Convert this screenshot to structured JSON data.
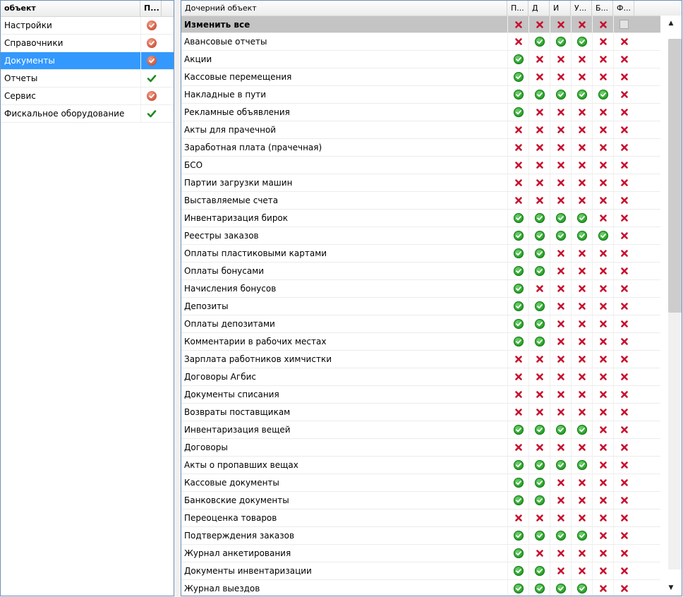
{
  "left": {
    "headers": [
      "объект",
      "П..."
    ],
    "rows": [
      {
        "name": "Настройки",
        "icon": "partial"
      },
      {
        "name": "Справочники",
        "icon": "partial"
      },
      {
        "name": "Документы",
        "icon": "partial",
        "selected": true
      },
      {
        "name": "Отчеты",
        "icon": "tick"
      },
      {
        "name": "Сервис",
        "icon": "partial"
      },
      {
        "name": "Фискальное оборудование",
        "icon": "tick"
      }
    ]
  },
  "right": {
    "headers": [
      "Дочерний объект",
      "П...",
      "Д",
      "И",
      "У...",
      "Б...",
      "Ф..."
    ],
    "all_row": {
      "name": "Изменить все",
      "cells": [
        "x",
        "x",
        "x",
        "x",
        "x",
        "empty"
      ]
    },
    "rows": [
      {
        "name": "Авансовые отчеты",
        "cells": [
          "x",
          "c",
          "c",
          "c",
          "x",
          "x"
        ]
      },
      {
        "name": "Акции",
        "cells": [
          "c",
          "x",
          "x",
          "x",
          "x",
          "x"
        ]
      },
      {
        "name": "Кассовые перемещения",
        "cells": [
          "c",
          "x",
          "x",
          "x",
          "x",
          "x"
        ]
      },
      {
        "name": "Накладные в пути",
        "cells": [
          "c",
          "c",
          "c",
          "c",
          "c",
          "x"
        ]
      },
      {
        "name": "Рекламные объявления",
        "cells": [
          "c",
          "x",
          "x",
          "x",
          "x",
          "x"
        ]
      },
      {
        "name": "Акты для прачечной",
        "cells": [
          "x",
          "x",
          "x",
          "x",
          "x",
          "x"
        ]
      },
      {
        "name": "Заработная плата (прачечная)",
        "cells": [
          "x",
          "x",
          "x",
          "x",
          "x",
          "x"
        ]
      },
      {
        "name": "БСО",
        "cells": [
          "x",
          "x",
          "x",
          "x",
          "x",
          "x"
        ]
      },
      {
        "name": "Партии загрузки машин",
        "cells": [
          "x",
          "x",
          "x",
          "x",
          "x",
          "x"
        ]
      },
      {
        "name": "Выставляемые счета",
        "cells": [
          "x",
          "x",
          "x",
          "x",
          "x",
          "x"
        ]
      },
      {
        "name": "Инвентаризация бирок",
        "cells": [
          "c",
          "c",
          "c",
          "c",
          "x",
          "x"
        ]
      },
      {
        "name": "Реестры заказов",
        "cells": [
          "c",
          "c",
          "c",
          "c",
          "c",
          "x"
        ]
      },
      {
        "name": "Оплаты пластиковыми картами",
        "cells": [
          "c",
          "c",
          "x",
          "x",
          "x",
          "x"
        ]
      },
      {
        "name": "Оплаты бонусами",
        "cells": [
          "c",
          "c",
          "x",
          "x",
          "x",
          "x"
        ]
      },
      {
        "name": "Начисления бонусов",
        "cells": [
          "c",
          "x",
          "x",
          "x",
          "x",
          "x"
        ]
      },
      {
        "name": "Депозиты",
        "cells": [
          "c",
          "c",
          "x",
          "x",
          "x",
          "x"
        ]
      },
      {
        "name": "Оплаты депозитами",
        "cells": [
          "c",
          "c",
          "x",
          "x",
          "x",
          "x"
        ]
      },
      {
        "name": "Комментарии в рабочих местах",
        "cells": [
          "c",
          "c",
          "x",
          "x",
          "x",
          "x"
        ]
      },
      {
        "name": "Зарплата работников химчистки",
        "cells": [
          "x",
          "x",
          "x",
          "x",
          "x",
          "x"
        ]
      },
      {
        "name": "Договоры Агбис",
        "cells": [
          "x",
          "x",
          "x",
          "x",
          "x",
          "x"
        ]
      },
      {
        "name": "Документы списания",
        "cells": [
          "x",
          "x",
          "x",
          "x",
          "x",
          "x"
        ]
      },
      {
        "name": "Возвраты поставщикам",
        "cells": [
          "x",
          "x",
          "x",
          "x",
          "x",
          "x"
        ]
      },
      {
        "name": "Инвентаризация вещей",
        "cells": [
          "c",
          "c",
          "c",
          "c",
          "x",
          "x"
        ]
      },
      {
        "name": "Договоры",
        "cells": [
          "x",
          "x",
          "x",
          "x",
          "x",
          "x"
        ]
      },
      {
        "name": "Акты о пропавших вещах",
        "cells": [
          "c",
          "c",
          "c",
          "c",
          "x",
          "x"
        ]
      },
      {
        "name": "Кассовые документы",
        "cells": [
          "c",
          "c",
          "x",
          "x",
          "x",
          "x"
        ]
      },
      {
        "name": "Банковские документы",
        "cells": [
          "c",
          "c",
          "x",
          "x",
          "x",
          "x"
        ]
      },
      {
        "name": "Переоценка товаров",
        "cells": [
          "x",
          "x",
          "x",
          "x",
          "x",
          "x"
        ]
      },
      {
        "name": "Подтверждения заказов",
        "cells": [
          "c",
          "c",
          "c",
          "c",
          "x",
          "x"
        ]
      },
      {
        "name": "Журнал анкетирования",
        "cells": [
          "c",
          "x",
          "x",
          "x",
          "x",
          "x"
        ]
      },
      {
        "name": "Документы инвентаризации",
        "cells": [
          "c",
          "c",
          "x",
          "x",
          "x",
          "x"
        ]
      },
      {
        "name": "Журнал выездов",
        "cells": [
          "c",
          "c",
          "c",
          "c",
          "x",
          "x"
        ]
      }
    ]
  },
  "scrollbar": {
    "up_glyph": "▲",
    "down_glyph": "▼"
  },
  "colors": {
    "selection": "#3399ff",
    "check": "#1e9b1e",
    "cross": "#c8102e",
    "partial": "#d0553a"
  }
}
